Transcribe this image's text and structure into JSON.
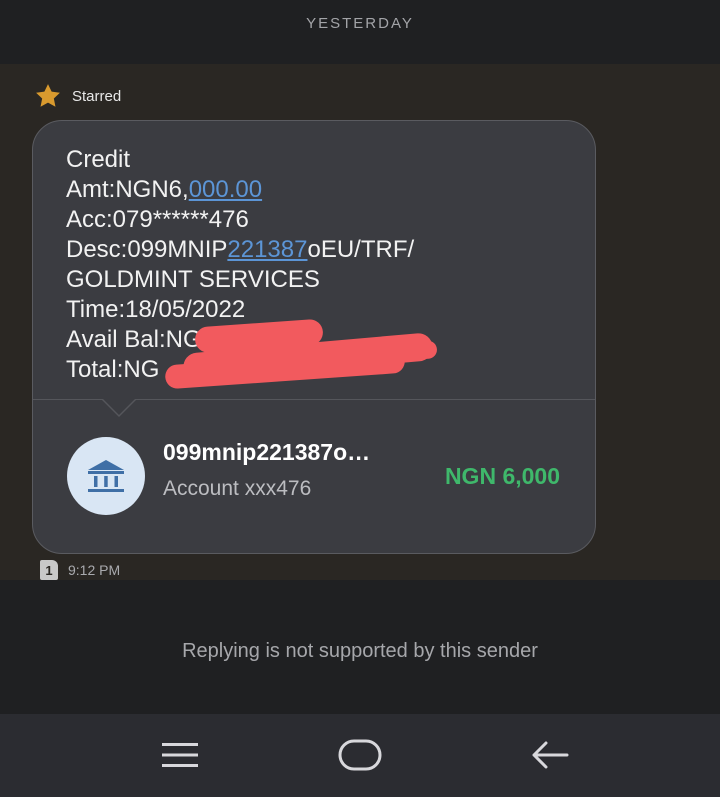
{
  "header": {
    "date_label": "YESTERDAY"
  },
  "starred": {
    "label": "Starred",
    "icon": "star-icon",
    "color": "#d99a2e"
  },
  "message": {
    "lines": [
      {
        "text": "Credit"
      },
      {
        "prefix": "Amt:NGN6,",
        "link": "000.00"
      },
      {
        "text": "Acc:079******476"
      },
      {
        "prefix": "Desc:099MNIP",
        "link": "221387",
        "suffix": "oEU/TRF/"
      },
      {
        "text": "GOLDMINT SERVICES"
      },
      {
        "text": "Time:18/05/2022"
      },
      {
        "text": "Avail Bal:NG"
      },
      {
        "text": "Total:NG"
      }
    ],
    "link_color": "#5c95d6",
    "redaction_color": "#f25a5e"
  },
  "transaction_card": {
    "icon": "bank-icon",
    "title": "099mnip221387o…",
    "account": "Account xxx476",
    "amount": "NGN 6,000",
    "amount_color": "#3fb86b"
  },
  "meta": {
    "sim": "1",
    "time": "9:12 PM"
  },
  "reply": {
    "notice": "Replying is not supported by this sender"
  },
  "nav": {
    "menu": "menu-icon",
    "home": "home-icon",
    "back": "back-icon"
  }
}
